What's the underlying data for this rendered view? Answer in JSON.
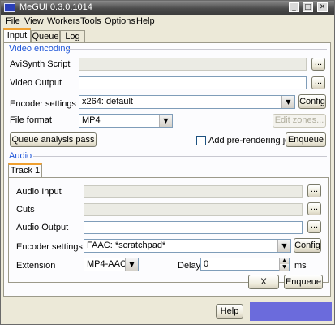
{
  "window": {
    "title": "MeGUI 0.3.0.1014",
    "minimize": "_",
    "maximize": "□",
    "close": "✕",
    "accent": "#6b6bdc"
  },
  "menu": {
    "file": "File",
    "view": "View",
    "workers": "Workers",
    "tools": "Tools",
    "options": "Options",
    "help": "Help"
  },
  "tabs": {
    "input": "Input",
    "queue": "Queue",
    "log": "Log"
  },
  "video": {
    "group_title": "Video encoding",
    "avisynth_label": "AviSynth Script",
    "avisynth_value": "",
    "output_label": "Video Output",
    "output_value": "",
    "encoder_label": "Encoder settings",
    "encoder_value": "x264: default",
    "config_label": "Config",
    "format_label": "File format",
    "format_value": "MP4",
    "edit_zones_label": "Edit zones...",
    "queue_analysis_label": "Queue analysis pass",
    "prerender_label": "Add pre-rendering job",
    "enqueue_label": "Enqueue",
    "browse_label": "..."
  },
  "audio": {
    "group_title": "Audio",
    "track_tab": "Track 1",
    "input_label": "Audio Input",
    "input_value": "",
    "cuts_label": "Cuts",
    "cuts_value": "",
    "output_label": "Audio Output",
    "output_value": "",
    "encoder_label": "Encoder settings",
    "encoder_value": "FAAC: *scratchpad*",
    "config_label": "Config",
    "extension_label": "Extension",
    "extension_value": "MP4-AAC",
    "delay_label": "Delay",
    "delay_value": "0",
    "delay_unit": "ms",
    "clear_label": "X",
    "enqueue_label": "Enqueue",
    "browse_label": "..."
  },
  "footer": {
    "help_label": "Help"
  },
  "icons": {
    "dropdown": "chevron-down-icon",
    "spin_up": "arrow-up-icon",
    "spin_down": "arrow-down-icon"
  }
}
